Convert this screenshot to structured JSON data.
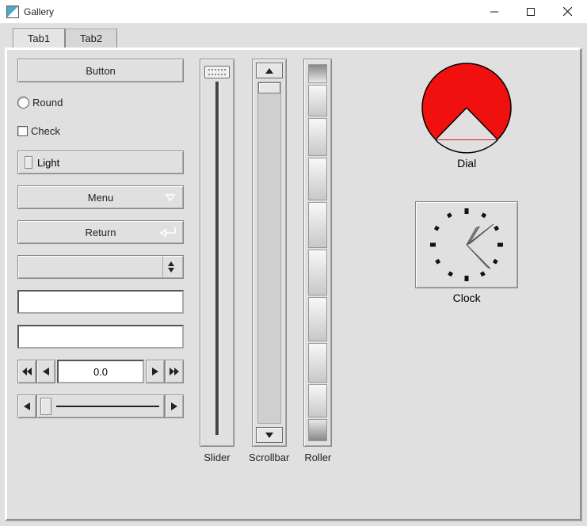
{
  "window": {
    "title": "Gallery"
  },
  "tabs": [
    "Tab1",
    "Tab2"
  ],
  "controls": {
    "button_label": "Button",
    "round_label": "Round",
    "check_label": "Check",
    "light_label": "Light",
    "menu_label": "Menu",
    "return_label": "Return",
    "choice_value": "",
    "input1_value": "",
    "input2_value": "",
    "counter_value": "0.0"
  },
  "vertical": {
    "slider_label": "Slider",
    "scrollbar_label": "Scrollbar",
    "roller_label": "Roller"
  },
  "dial": {
    "label": "Dial",
    "color": "#f01010"
  },
  "clock": {
    "label": "Clock",
    "hour": 1,
    "minute": 10
  }
}
